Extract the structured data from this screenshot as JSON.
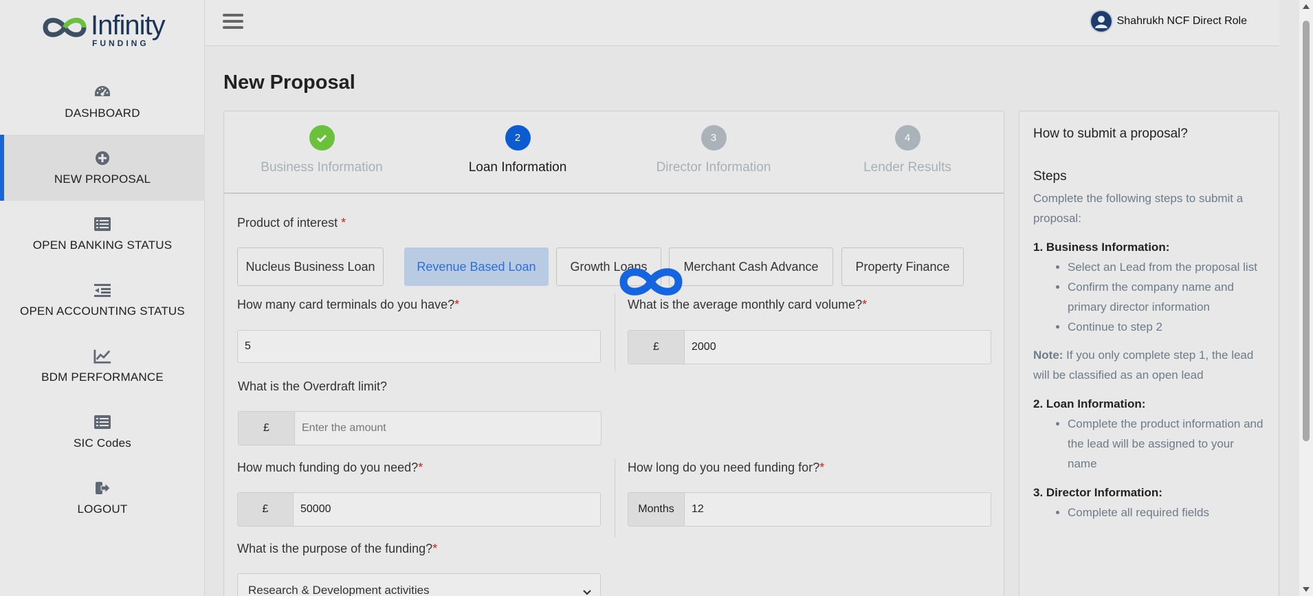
{
  "brand": {
    "name": "Infinity",
    "sub": "FUNDING"
  },
  "sidebar": {
    "items": [
      {
        "label": "DASHBOARD",
        "icon": "dashboard-icon"
      },
      {
        "label": "NEW PROPOSAL",
        "icon": "plus-circle-icon",
        "active": true
      },
      {
        "label": "OPEN BANKING STATUS",
        "icon": "list-icon"
      },
      {
        "label": "OPEN ACCOUNTING STATUS",
        "icon": "indent-icon"
      },
      {
        "label": "BDM PERFORMANCE",
        "icon": "chart-line-icon"
      },
      {
        "label": "SIC Codes",
        "icon": "list-icon"
      },
      {
        "label": "LOGOUT",
        "icon": "logout-icon"
      }
    ]
  },
  "topbar": {
    "user_name": "Shahrukh NCF Direct Role"
  },
  "page": {
    "title": "New Proposal"
  },
  "stepper": {
    "steps": [
      {
        "num": "1",
        "label": "Business Information",
        "state": "done"
      },
      {
        "num": "2",
        "label": "Loan Information",
        "state": "current"
      },
      {
        "num": "3",
        "label": "Director Information",
        "state": "todo"
      },
      {
        "num": "4",
        "label": "Lender Results",
        "state": "todo"
      }
    ]
  },
  "form": {
    "product_label": "Product of interest",
    "products": [
      {
        "label": "Nucleus Business Loan"
      },
      {
        "label": "Revenue Based Loan",
        "active": true
      },
      {
        "label": "Growth Loans"
      },
      {
        "label": "Merchant Cash Advance"
      },
      {
        "label": "Property Finance"
      }
    ],
    "terminals_label": "How many card terminals do you have?",
    "terminals_value": "5",
    "card_volume_label": "What is the average monthly card volume?",
    "currency_symbol": "£",
    "card_volume_value": "2000",
    "overdraft_label": "What is the Overdraft limit?",
    "overdraft_placeholder": "Enter the amount",
    "funding_label": "How much funding do you need?",
    "funding_value": "50000",
    "duration_label": "How long do you need funding for?",
    "duration_prefix": "Months",
    "duration_value": "12",
    "purpose_label": "What is the purpose of the funding?",
    "purpose_value": "Research & Development activities",
    "required_mark": "*"
  },
  "help": {
    "title": "How to submit a proposal?",
    "steps_heading": "Steps",
    "intro": "Complete the following steps to submit a proposal:",
    "s1_title": "1. Business Information:",
    "s1_items": [
      "Select an Lead from the proposal list",
      "Confirm the company name and primary director information",
      "Continue to step 2"
    ],
    "note_label": "Note:",
    "note_text": " If you only complete step 1, the lead will be classified as an open lead",
    "s2_title": "2. Loan Information:",
    "s2_items": [
      "Complete the product information and the lead will be assigned to your name"
    ],
    "s3_title": "3. Director Information:",
    "s3_items": [
      "Complete all required fields"
    ]
  },
  "colors": {
    "accent": "#1a64d3",
    "done": "#6ac13b",
    "todo": "#a9b3b9",
    "required": "#d0201a",
    "brand": "#1a3557"
  }
}
